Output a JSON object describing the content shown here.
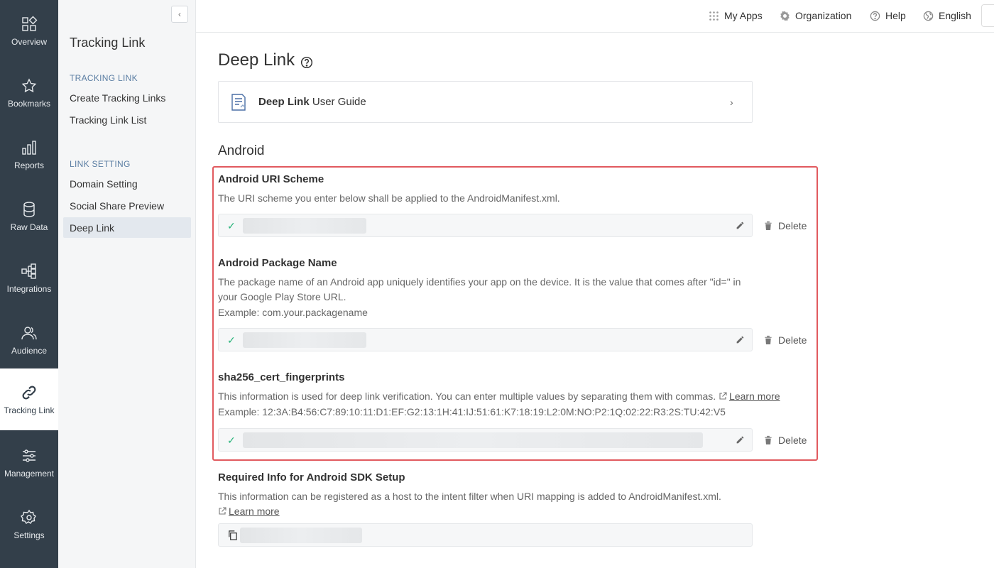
{
  "rail": [
    {
      "label": "Overview"
    },
    {
      "label": "Bookmarks"
    },
    {
      "label": "Reports"
    },
    {
      "label": "Raw Data"
    },
    {
      "label": "Integrations"
    },
    {
      "label": "Audience"
    },
    {
      "label": "Tracking Link"
    },
    {
      "label": "Management"
    },
    {
      "label": "Settings"
    }
  ],
  "subnav": {
    "title": "Tracking Link",
    "groups": [
      "TRACKING LINK",
      "LINK SETTING"
    ],
    "links": [
      "Create Tracking Links",
      "Tracking Link List",
      "Domain Setting",
      "Social Share Preview",
      "Deep Link"
    ]
  },
  "topbar": {
    "my_apps": "My Apps",
    "organization": "Organization",
    "help": "Help",
    "language": "English"
  },
  "page": {
    "title": "Deep Link",
    "guide_bold": "Deep Link",
    "guide_rest": " User Guide",
    "section": "Android"
  },
  "fields": {
    "uri_scheme": {
      "label": "Android URI Scheme",
      "desc": "The URI scheme you enter below shall be applied to the AndroidManifest.xml."
    },
    "package": {
      "label": "Android Package Name",
      "desc1": "The package name of an Android app uniquely identifies your app on the device. It is the value that comes after \"id=\" in",
      "desc2": "your Google Play Store URL.",
      "example": "Example: com.your.packagename"
    },
    "sha256": {
      "label": "sha256_cert_fingerprints",
      "desc": "This information is used for deep link verification. You can enter multiple values by separating them with commas.",
      "learn_more": "Learn more",
      "example": "Example: 12:3A:B4:56:C7:89:10:11:D1:EF:G2:13:1H:41:IJ:51:61:K7:18:19:L2:0M:NO:P2:1Q:02:22:R3:2S:TU:42:V5"
    },
    "sdk": {
      "label": "Required Info for Android SDK Setup",
      "desc": "This information can be registered as a host to the intent filter when URI mapping is added to AndroidManifest.xml.",
      "learn_more": "Learn more"
    }
  },
  "delete_label": "Delete",
  "colors": {
    "rail": "#333f4a",
    "highlight": "#e15a5f",
    "check": "#28b47a"
  }
}
